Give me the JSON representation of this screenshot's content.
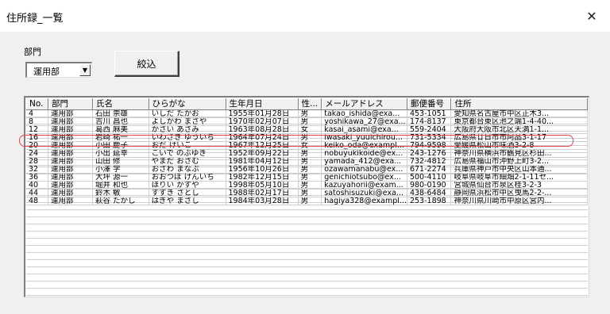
{
  "window": {
    "title": "住所録_一覧",
    "close_glyph": "✕"
  },
  "filter": {
    "dept_label": "部門",
    "dept_value": "運用部",
    "dropdown_arrow": "▼",
    "filter_button": "絞込"
  },
  "table": {
    "columns": [
      "No.",
      "部門",
      "氏名",
      "ひらがな",
      "生年月日",
      "性...",
      "メールアドレス",
      "郵便番号",
      "住所"
    ],
    "rows": [
      [
        "4",
        "運用部",
        "石田 崇雄",
        "いしだ たかお",
        "1955年01月28日",
        "男",
        "takao_ishida@exa...",
        "453-1051",
        "愛知県名古屋市中区正木3..."
      ],
      [
        "8",
        "運用部",
        "吉川 昌也",
        "よしかわ まさや",
        "1970年02月07日",
        "男",
        "yoshikawa_27@exa...",
        "174-8137",
        "東京都台東区池之端1-4-40..."
      ],
      [
        "12",
        "運用部",
        "葛西 麻美",
        "かさい あさみ",
        "1963年08月28日",
        "女",
        "kasai_asami@exa...",
        "559-2404",
        "大阪府大阪市北区天満1-1..."
      ],
      [
        "16",
        "運用部",
        "岩崎 祐一",
        "いわさき ゆういち",
        "1964年07月24日",
        "男",
        "iwasaki_yuuichirou...",
        "731-5334",
        "広島県廿日市市阿品3-1-17"
      ],
      [
        "20",
        "運用部",
        "小田 慶子",
        "おだ けいこ",
        "1967年12月25日",
        "女",
        "keiko_oda@exampl...",
        "794-9598",
        "愛媛県松山市味酒3-2-8"
      ],
      [
        "24",
        "運用部",
        "小出 延幸",
        "こいで のぶゆき",
        "1952年09月22日",
        "男",
        "nobuyukikoide@ex...",
        "243-1276",
        "神奈川県横浜市鶴見区杉田..."
      ],
      [
        "28",
        "運用部",
        "山田 修",
        "やまだ おさむ",
        "1981年04月12日",
        "男",
        "yamada_412@exa...",
        "732-4812",
        "広島県福山市沖野上町3-2..."
      ],
      [
        "32",
        "運用部",
        "小澤 学",
        "おざわ まなぶ",
        "1956年10月26日",
        "男",
        "ozawamanabu@ex...",
        "671-2274",
        "兵庫県神戸市中央区山本通..."
      ],
      [
        "36",
        "運用部",
        "大坪 源一",
        "おおつぼ げんいち",
        "1982年12月15日",
        "男",
        "genichiotsubo@ex...",
        "500-4110",
        "岐阜県岐阜市細畑2-1-11セ..."
      ],
      [
        "40",
        "運用部",
        "堀井 和也",
        "ほりい かずや",
        "1998年05月10日",
        "男",
        "kazuyahorii@exam...",
        "980-0190",
        "宮城県仙台市泉区桂3-2-3"
      ],
      [
        "44",
        "運用部",
        "鈴木 敏",
        "すずき さとし",
        "1988年02月17日",
        "男",
        "satoshisuzuki@exa...",
        "438-6484",
        "静岡県浜松市中区曳馬2-2-..."
      ],
      [
        "48",
        "運用部",
        "萩谷 たかし",
        "はぎや まさし",
        "1984年03月28日",
        "男",
        "hagiya328@exampl...",
        "253-1898",
        "神奈川県川崎市中原区宮内..."
      ]
    ]
  }
}
